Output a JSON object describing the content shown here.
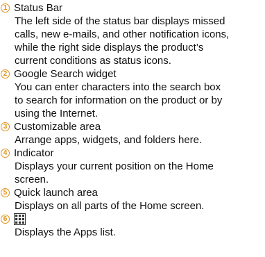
{
  "items": [
    {
      "number": "1",
      "title": "Status Bar",
      "description_lines": [
        "The left side of the status bar displays missed",
        "calls, new e-mails, and other notification icons,",
        "while the right side displays the product’s",
        "current conditions as status icons."
      ]
    },
    {
      "number": "2",
      "title": "Google Search widget",
      "description_lines": [
        "You can enter characters into the search box",
        "to search for information on the product or by",
        "using the Internet."
      ]
    },
    {
      "number": "3",
      "title": "Customizable area",
      "description_lines": [
        "Arrange apps, widgets, and folders here."
      ]
    },
    {
      "number": "4",
      "title": "Indicator",
      "description_lines": [
        "Displays your current position on the Home",
        "screen."
      ]
    },
    {
      "number": "5",
      "title": "Quick launch area",
      "description_lines": [
        "Displays on all parts of the Home screen."
      ]
    },
    {
      "number": "6",
      "title_icon": "apps-grid-icon",
      "description_lines": [
        "Displays the Apps list."
      ]
    }
  ],
  "colors": {
    "number_badge": "#e0901a",
    "text": "#111111"
  }
}
